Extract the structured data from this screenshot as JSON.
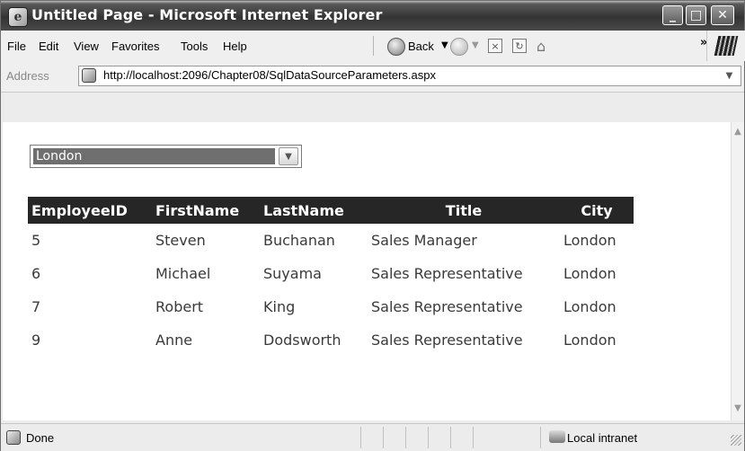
{
  "window": {
    "title": "Untitled Page - Microsoft Internet Explorer",
    "min_glyph": "_",
    "max_glyph": "□",
    "close_glyph": "✕"
  },
  "menu": {
    "items": [
      "File",
      "Edit",
      "View",
      "Favorites",
      "Tools",
      "Help"
    ],
    "back_label": "Back",
    "overflow_glyph": "»"
  },
  "address": {
    "label": "Address",
    "url": "http://localhost:2096/Chapter08/SqlDataSourceParameters.aspx"
  },
  "page": {
    "city_select": {
      "selected": "London"
    },
    "grid": {
      "columns": [
        "EmployeeID",
        "FirstName",
        "LastName",
        "Title",
        "City"
      ],
      "rows": [
        [
          "5",
          "Steven",
          "Buchanan",
          "Sales Manager",
          "London"
        ],
        [
          "6",
          "Michael",
          "Suyama",
          "Sales Representative",
          "London"
        ],
        [
          "7",
          "Robert",
          "King",
          "Sales Representative",
          "London"
        ],
        [
          "9",
          "Anne",
          "Dodsworth",
          "Sales Representative",
          "London"
        ]
      ]
    }
  },
  "status": {
    "text": "Done",
    "zone": "Local intranet"
  }
}
